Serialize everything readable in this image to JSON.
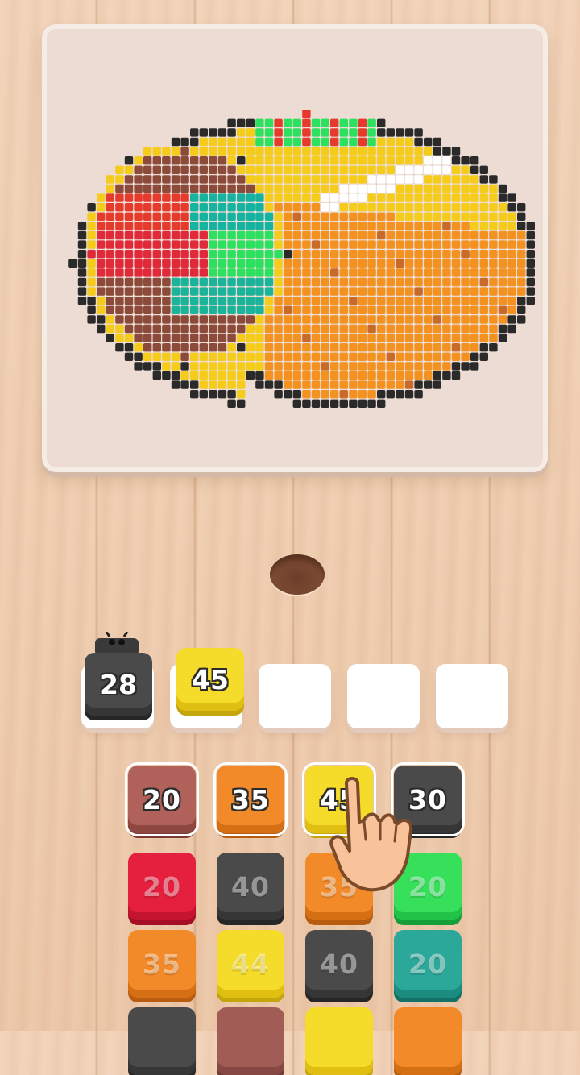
{
  "colors": {
    "brown": "#b0615a",
    "orange": "#f28a2a",
    "yellow": "#f6dc2a",
    "dark": "#4a4a4a",
    "red": "#e51f3e",
    "green": "#36e05a",
    "teal": "#2ba89a"
  },
  "picture": {
    "subject_icon": "taco-pixel-art-icon"
  },
  "slots": {
    "filled": [
      {
        "value": "28",
        "color": "dark",
        "has_lock": true
      },
      {
        "value": "45",
        "color": "yellow"
      }
    ],
    "empty_count": 3
  },
  "grid": {
    "rows": [
      [
        {
          "value": "20",
          "color": "brown"
        },
        {
          "value": "35",
          "color": "orange"
        },
        {
          "value": "45",
          "color": "yellow"
        },
        {
          "value": "30",
          "color": "dark"
        }
      ],
      [
        {
          "value": "20",
          "color": "red"
        },
        {
          "value": "40",
          "color": "dark"
        },
        {
          "value": "35",
          "color": "orange"
        },
        {
          "value": "20",
          "color": "green"
        }
      ],
      [
        {
          "value": "35",
          "color": "orange"
        },
        {
          "value": "44",
          "color": "yellow"
        },
        {
          "value": "40",
          "color": "dark"
        },
        {
          "value": "20",
          "color": "teal"
        }
      ]
    ]
  }
}
